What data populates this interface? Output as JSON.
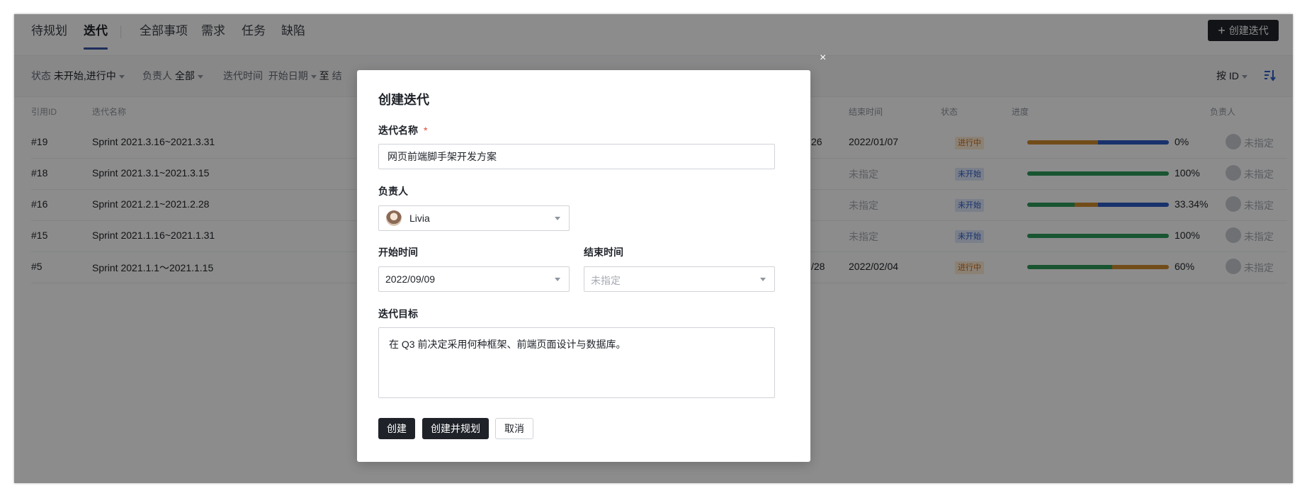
{
  "tabs": [
    {
      "label": "待规划"
    },
    {
      "label": "迭代",
      "active": true
    },
    {
      "label": "全部事项"
    },
    {
      "label": "需求"
    },
    {
      "label": "任务"
    },
    {
      "label": "缺陷"
    }
  ],
  "create_button": "创建迭代",
  "filters": {
    "status_label": "状态",
    "status_value": "未开始,进行中",
    "owner_label": "负责人",
    "owner_value": "全部",
    "time_label": "迭代时间",
    "start_placeholder": "开始日期",
    "to": "至",
    "end_partial": "结"
  },
  "sort": {
    "label": "按 ID"
  },
  "columns": {
    "id": "引用ID",
    "name": "迭代名称",
    "end": "结束时间",
    "status": "状态",
    "progress": "进度",
    "owner": "负责人"
  },
  "rows": [
    {
      "id": "#19",
      "name": "Sprint 2021.3.16~2021.3.31",
      "start_tail": "26",
      "end": "2022/01/07",
      "status": "进行中",
      "status_type": "going",
      "progress": "0%",
      "segments": [
        {
          "color": "#d08a2c",
          "pct": 50
        },
        {
          "color": "#2c5cc5",
          "pct": 50
        }
      ],
      "owner": "未指定"
    },
    {
      "id": "#18",
      "name": "Sprint 2021.3.1~2021.3.15",
      "start_tail": "",
      "end": "未指定",
      "status": "未开始",
      "status_type": "notstart",
      "progress": "100%",
      "segments": [
        {
          "color": "#2f9c5a",
          "pct": 100
        }
      ],
      "owner": "未指定"
    },
    {
      "id": "#16",
      "name": "Sprint 2021.2.1~2021.2.28",
      "start_tail": "",
      "end": "未指定",
      "status": "未开始",
      "status_type": "notstart",
      "progress": "33.34%",
      "segments": [
        {
          "color": "#2f9c5a",
          "pct": 33.34
        },
        {
          "color": "#d08a2c",
          "pct": 16.66
        },
        {
          "color": "#2c5cc5",
          "pct": 50
        }
      ],
      "owner": "未指定"
    },
    {
      "id": "#15",
      "name": "Sprint 2021.1.16~2021.1.31",
      "start_tail": "",
      "end": "未指定",
      "status": "未开始",
      "status_type": "notstart",
      "progress": "100%",
      "segments": [
        {
          "color": "#2f9c5a",
          "pct": 100
        }
      ],
      "owner": "未指定"
    },
    {
      "id": "#5",
      "name": "Sprint 2021.1.1～2021.1.15",
      "start_tail": "/28",
      "end": "2022/02/04",
      "status": "进行中",
      "status_type": "going",
      "progress": "60%",
      "segments": [
        {
          "color": "#2f9c5a",
          "pct": 60
        },
        {
          "color": "#d08a2c",
          "pct": 40
        }
      ],
      "owner": "未指定"
    }
  ],
  "close_icon": "×",
  "modal": {
    "title": "创建迭代",
    "name_label": "迭代名称",
    "required_mark": "*",
    "name_value": "网页前端脚手架开发方案",
    "owner_label": "负责人",
    "owner_value": "Livia",
    "start_label": "开始时间",
    "start_value": "2022/09/09",
    "end_label": "结束时间",
    "end_placeholder": "未指定",
    "goal_label": "迭代目标",
    "goal_value": "在 Q3 前决定采用何种框架、前端页面设计与数据库。",
    "buttons": {
      "create": "创建",
      "create_plan": "创建并规划",
      "cancel": "取消"
    }
  }
}
